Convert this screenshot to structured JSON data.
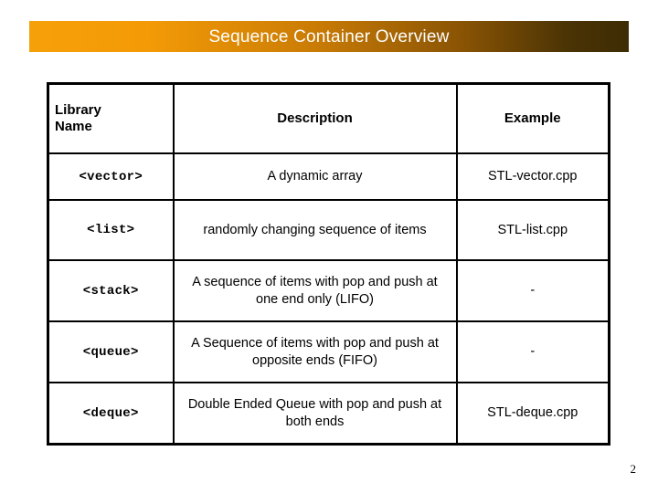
{
  "slide": {
    "title": "Sequence Container Overview",
    "page_number": "2",
    "banner_gradient_start": "#F6A009",
    "banner_gradient_end": "#3E2C04",
    "title_color": "#FFFFFF",
    "border_color": "#000000",
    "background_color": "#FFFFFF"
  },
  "table": {
    "headers": {
      "library_name": "Library\nName",
      "library_name_line1": "Library",
      "library_name_line2": "Name",
      "description": "Description",
      "example": "Example"
    },
    "rows": [
      {
        "library_name": "<vector>",
        "description": "A dynamic array",
        "example": "STL-vector.cpp"
      },
      {
        "library_name": "<list>",
        "description": "randomly changing sequence of items",
        "example": "STL-list.cpp"
      },
      {
        "library_name": "<stack>",
        "description": "A sequence of items with pop and push at one end only (LIFO)",
        "example": "-"
      },
      {
        "library_name": "<queue>",
        "description": "A Sequence of items with pop and push at opposite ends (FIFO)",
        "example": "-"
      },
      {
        "library_name": "<deque>",
        "description": "Double Ended Queue with pop and push at both ends",
        "example": "STL-deque.cpp"
      }
    ]
  }
}
